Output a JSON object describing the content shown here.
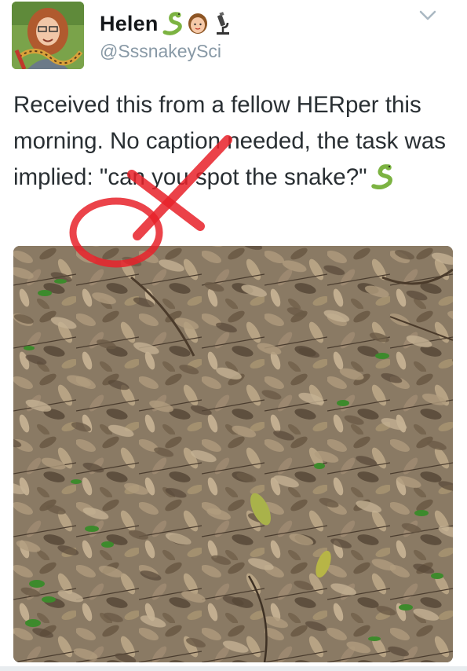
{
  "author": {
    "display_name": "Helen",
    "handle": "@SssnakeySci",
    "avatar_icon": "avatar-woman-with-snake",
    "name_emojis": [
      "snake-emoji",
      "woman-face-emoji",
      "microscope-emoji"
    ]
  },
  "tweet": {
    "text": "Received this from a fellow HERper this morning. No caption needed, the task was implied: \"can you spot the snake?\"",
    "trailing_emoji": "snake-emoji"
  },
  "header": {
    "more_icon": "chevron-down-icon"
  },
  "media": {
    "description_icon": "photo-leaf-litter",
    "annotation": "red-circle-and-x"
  },
  "colors": {
    "name": "#14171a",
    "handle": "#8899a6",
    "text": "#292f33",
    "annotation_red": "#e8222a"
  }
}
